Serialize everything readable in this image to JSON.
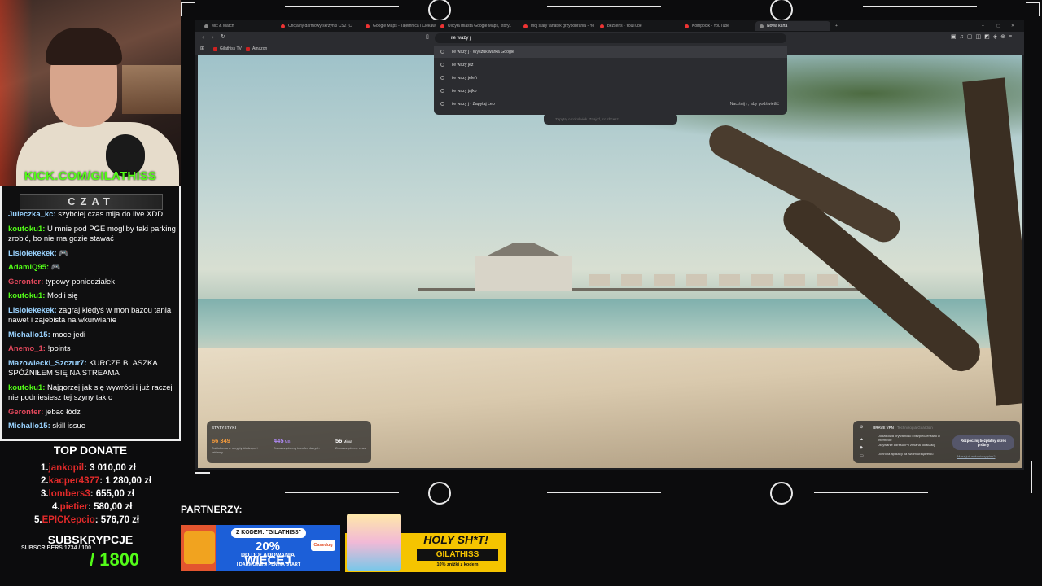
{
  "stream": {
    "kick_handle": "KICK.COM/GILATHISS",
    "chat_title": "CZAT",
    "top_donate_title": "TOP DONATE",
    "subs_title": "SUBSKRYPCJE",
    "subs_small": "SUBSCRIBERS 1734 / 100",
    "subs_goal": "/ 1800",
    "partners_title": "PARTNERZY:"
  },
  "chat": [
    {
      "nick": "Juleczka_kc:",
      "color": "#9ad3ff",
      "text": " szybciej czas mija do live XDD"
    },
    {
      "nick": "koutoku1:",
      "color": "#53fc18",
      "text": " U mnie pod PGE mogliby taki parking zrobić, bo nie ma gdzie stawać"
    },
    {
      "nick": "Lisiolekekek:",
      "color": "#9ad3ff",
      "text": " 🎮"
    },
    {
      "nick": "AdamiQ95:",
      "color": "#53fc18",
      "text": " 🎮"
    },
    {
      "nick": "Geronter:",
      "color": "#e0475b",
      "text": " typowy poniedziałek"
    },
    {
      "nick": "koutoku1:",
      "color": "#53fc18",
      "text": " Modli się"
    },
    {
      "nick": "Lisiolekekek:",
      "color": "#9ad3ff",
      "text": " zagraj kiedyś w mon bazou tania nawet i zajebista na wkurwianie"
    },
    {
      "nick": "Michallo15:",
      "color": "#9ad3ff",
      "text": " moce jedi"
    },
    {
      "nick": "Anemo_1:",
      "color": "#e0475b",
      "text": " !points"
    },
    {
      "nick": "Mazowiecki_Szczur7:",
      "color": "#9ad3ff",
      "text": " KURCZE BLASZKA SPÓŹNIŁEM SIĘ NA STREAMA"
    },
    {
      "nick": "koutoku1:",
      "color": "#53fc18",
      "text": " Najgorzej jak się wywróci i już raczej nie podniesiesz tej szyny tak o"
    },
    {
      "nick": "Geronter:",
      "color": "#e0475b",
      "text": " jebac łódz"
    },
    {
      "nick": "Michallo15:",
      "color": "#9ad3ff",
      "text": " skill issue"
    }
  ],
  "donors": [
    {
      "rank": "1.",
      "name": "jankopil",
      "amount": ": 3 010,00 zł"
    },
    {
      "rank": "2.",
      "name": "kacper4377",
      "amount": ": 1 280,00 zł"
    },
    {
      "rank": "3.",
      "name": "lombers3",
      "amount": ": 655,00 zł"
    },
    {
      "rank": "4.",
      "name": "pietier",
      "amount": ": 580,00 zł"
    },
    {
      "rank": "5.",
      "name": "EPICKepcio",
      "amount": ": 576,70 zł"
    }
  ],
  "browser": {
    "tabs": [
      "Mix & Match",
      "Oficjalny darmowy skrzynki CS2 (CSG...",
      "Google Maps - Tajemnica i Ciekawost...",
      "Ulicyła miasta Google Maps, który...",
      "mój stary fanatyk grzybobrania - YouT...",
      "bezsens - YouTube",
      "Kompocik - YouTube",
      "Nowa karta"
    ],
    "url_value": "ile wazy j",
    "bookmarks": [
      "Gilathiss TV",
      "Amazon"
    ],
    "suggestions": [
      {
        "text": "ile wazy j - Wyszukiwarka Google",
        "hint": ""
      },
      {
        "text": "ile wazy jez",
        "hint": ""
      },
      {
        "text": "ile wazy jeleń",
        "hint": ""
      },
      {
        "text": "ile wazy jajko",
        "hint": ""
      },
      {
        "text": "ile wazy j - Zapytaj Leo",
        "hint": "Naciśnij ↑, aby podświetlić"
      }
    ],
    "leo_placeholder": "Zapytaj o cokolwiek. Znajdź, co chcesz...",
    "stats": {
      "title": "STATYSTYKI",
      "items": [
        {
          "value": "66 349",
          "unit": "",
          "desc": "Zablokowane skrypty śledzące i reklamy",
          "color": "#f39a3c"
        },
        {
          "value": "445",
          "unit": " MB",
          "desc": "Zaoszczędzony transfer danych",
          "color": "#b58cff"
        },
        {
          "value": "56",
          "unit": " Minut",
          "desc": "Zaoszczędzony czas",
          "color": "#ffffff"
        }
      ]
    },
    "vpn": {
      "title": "BRAVE VPN",
      "subtitle": "Technologia Guardian",
      "items": [
        "Dodatkowa prywatność i bezpieczeństwo w Internecie",
        "Ukrywanie adresu IP i zmiana lokalizacji",
        "Ochrona aplikacji na twoim urządzeniu"
      ],
      "button": "Rozpocznij bezpłatny okres próbny",
      "link": "Masz już wykupiony plan?"
    }
  },
  "partners": {
    "p1_code": "Z KODEM: \"GILATHISS\"",
    "p1_big": "20% WIĘCEJ",
    "p1_line2": "DO DOŁADOWANIA",
    "p1_small": "I DARMOWE 4 PLN NA START",
    "p1_brand": "Casedug",
    "p2_title": "HOLY SH*T!",
    "p2_code": "GILATHISS",
    "p2_small": "10% zniżki z kodem"
  },
  "colors": {
    "kick_green": "#53fc18",
    "donor_red": "#e12a2a",
    "frame": "#e9e9e9"
  }
}
